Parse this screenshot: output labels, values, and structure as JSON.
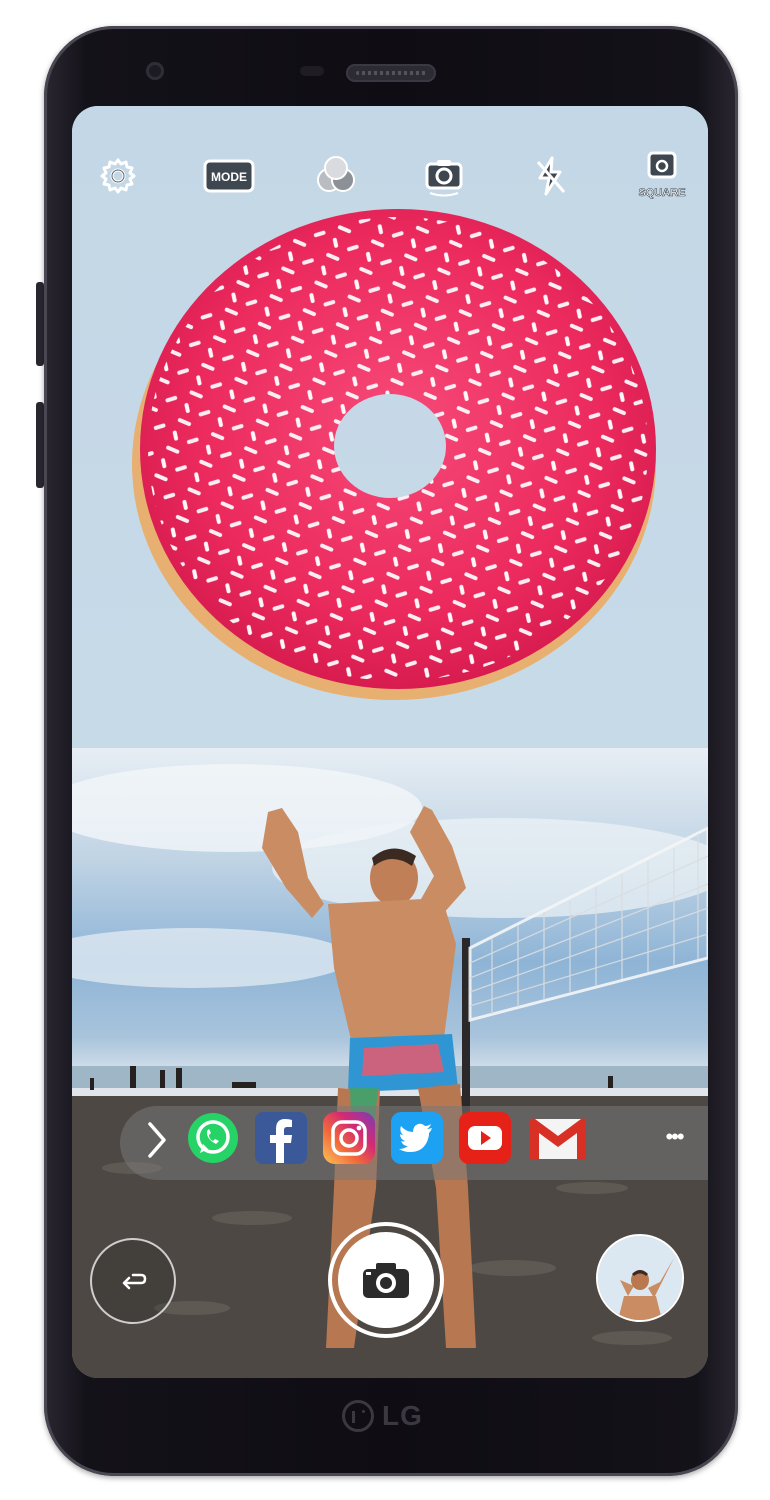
{
  "device": {
    "brand": "LG"
  },
  "toolbar": {
    "items": [
      {
        "icon": "gear-icon"
      },
      {
        "icon": "mode-icon",
        "label": "MODE"
      },
      {
        "icon": "filter-icon"
      },
      {
        "icon": "camera-switch-icon"
      },
      {
        "icon": "flash-off-icon"
      },
      {
        "icon": "square-mode-icon",
        "label": "SQUARE"
      }
    ]
  },
  "share": {
    "apps": [
      {
        "name": "WhatsApp",
        "icon": "whatsapp-icon",
        "color": "#25d366"
      },
      {
        "name": "Facebook",
        "icon": "facebook-icon",
        "color": "#3b5998"
      },
      {
        "name": "Instagram",
        "icon": "instagram-icon",
        "color": "#c13584"
      },
      {
        "name": "Twitter",
        "icon": "twitter-icon",
        "color": "#1da1f2"
      },
      {
        "name": "YouTube",
        "icon": "youtube-icon",
        "color": "#e62117"
      },
      {
        "name": "Gmail",
        "icon": "gmail-icon",
        "color": "#d93025"
      }
    ],
    "more": "•••"
  },
  "colors": {
    "donut_glaze": "#ee2a5f",
    "sky_top": "#c4d7e6",
    "sand": "#4d4843"
  }
}
